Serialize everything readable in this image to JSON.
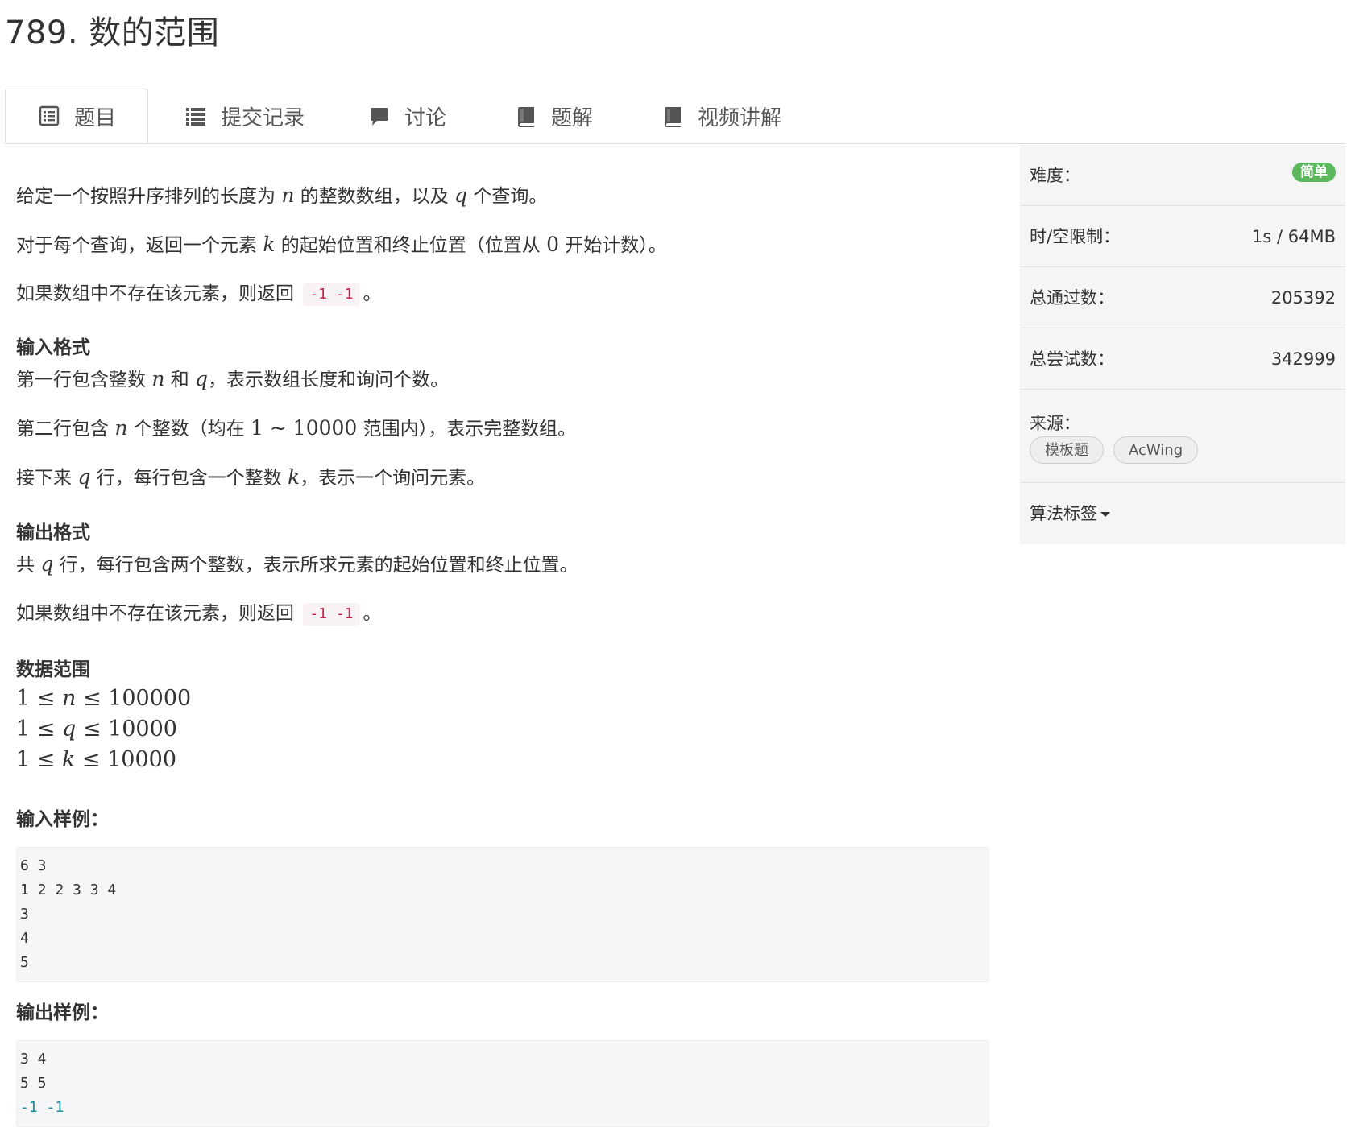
{
  "page": {
    "title": "789. 数的范围"
  },
  "tabs": [
    {
      "label": "题目",
      "icon": "list-alt-icon"
    },
    {
      "label": "提交记录",
      "icon": "list-icon"
    },
    {
      "label": "讨论",
      "icon": "comment-icon"
    },
    {
      "label": "题解",
      "icon": "book-icon"
    },
    {
      "label": "视频讲解",
      "icon": "book-icon"
    }
  ],
  "problem": {
    "p1": {
      "a": "给定一个按照升序排列的长度为 ",
      "v1": "n",
      "b": " 的整数数组，以及 ",
      "v2": "q",
      "c": " 个查询。"
    },
    "p2": {
      "a": "对于每个查询，返回一个元素 ",
      "v1": "k",
      "b": " 的起始位置和终止位置（位置从 ",
      "n1": "0",
      "c": " 开始计数）。"
    },
    "p3": {
      "a": "如果数组中不存在该元素，则返回 ",
      "code": "-1 -1",
      "b": "。"
    },
    "input_format_title": "输入格式",
    "p4": {
      "a": "第一行包含整数 ",
      "v1": "n",
      "b": " 和 ",
      "v2": "q",
      "c": "，表示数组长度和询问个数。"
    },
    "p5": {
      "a": "第二行包含 ",
      "v1": "n",
      "b": " 个整数（均在 ",
      "n1": "1 ∼ 10000",
      "c": " 范围内），表示完整数组。"
    },
    "p6": {
      "a": "接下来 ",
      "v1": "q",
      "b": " 行，每行包含一个整数 ",
      "v2": "k",
      "c": "，表示一个询问元素。"
    },
    "output_format_title": "输出格式",
    "p7": {
      "a": "共 ",
      "v1": "q",
      "b": " 行，每行包含两个整数，表示所求元素的起始位置和终止位置。"
    },
    "p8": {
      "a": "如果数组中不存在该元素，则返回 ",
      "code": "-1 -1",
      "b": "。"
    },
    "range_title": "数据范围",
    "ranges": [
      {
        "lo": "1 ≤ ",
        "v": "n",
        "hi": " ≤ 100000"
      },
      {
        "lo": "1 ≤ ",
        "v": "q",
        "hi": " ≤ 10000"
      },
      {
        "lo": "1 ≤ ",
        "v": "k",
        "hi": " ≤ 10000"
      }
    ],
    "sample_input_title": "输入样例：",
    "sample_input": [
      "6 3",
      "1 2 2 3 3 4",
      "3",
      "4",
      "5"
    ],
    "sample_output_title": "输出样例：",
    "sample_output": [
      "3 4",
      "5 5",
      "-1 -1"
    ]
  },
  "sidebar": {
    "difficulty_label": "难度：",
    "difficulty_value": "简单",
    "difficulty_color": "#5cb85c",
    "limit_label": "时/空限制：",
    "limit_value": "1s / 64MB",
    "passed_label": "总通过数：",
    "passed_value": "205392",
    "tried_label": "总尝试数：",
    "tried_value": "342999",
    "source_label": "来源：",
    "source_tags": [
      "模板题",
      "AcWing"
    ],
    "algo_tags_label": "算法标签"
  }
}
